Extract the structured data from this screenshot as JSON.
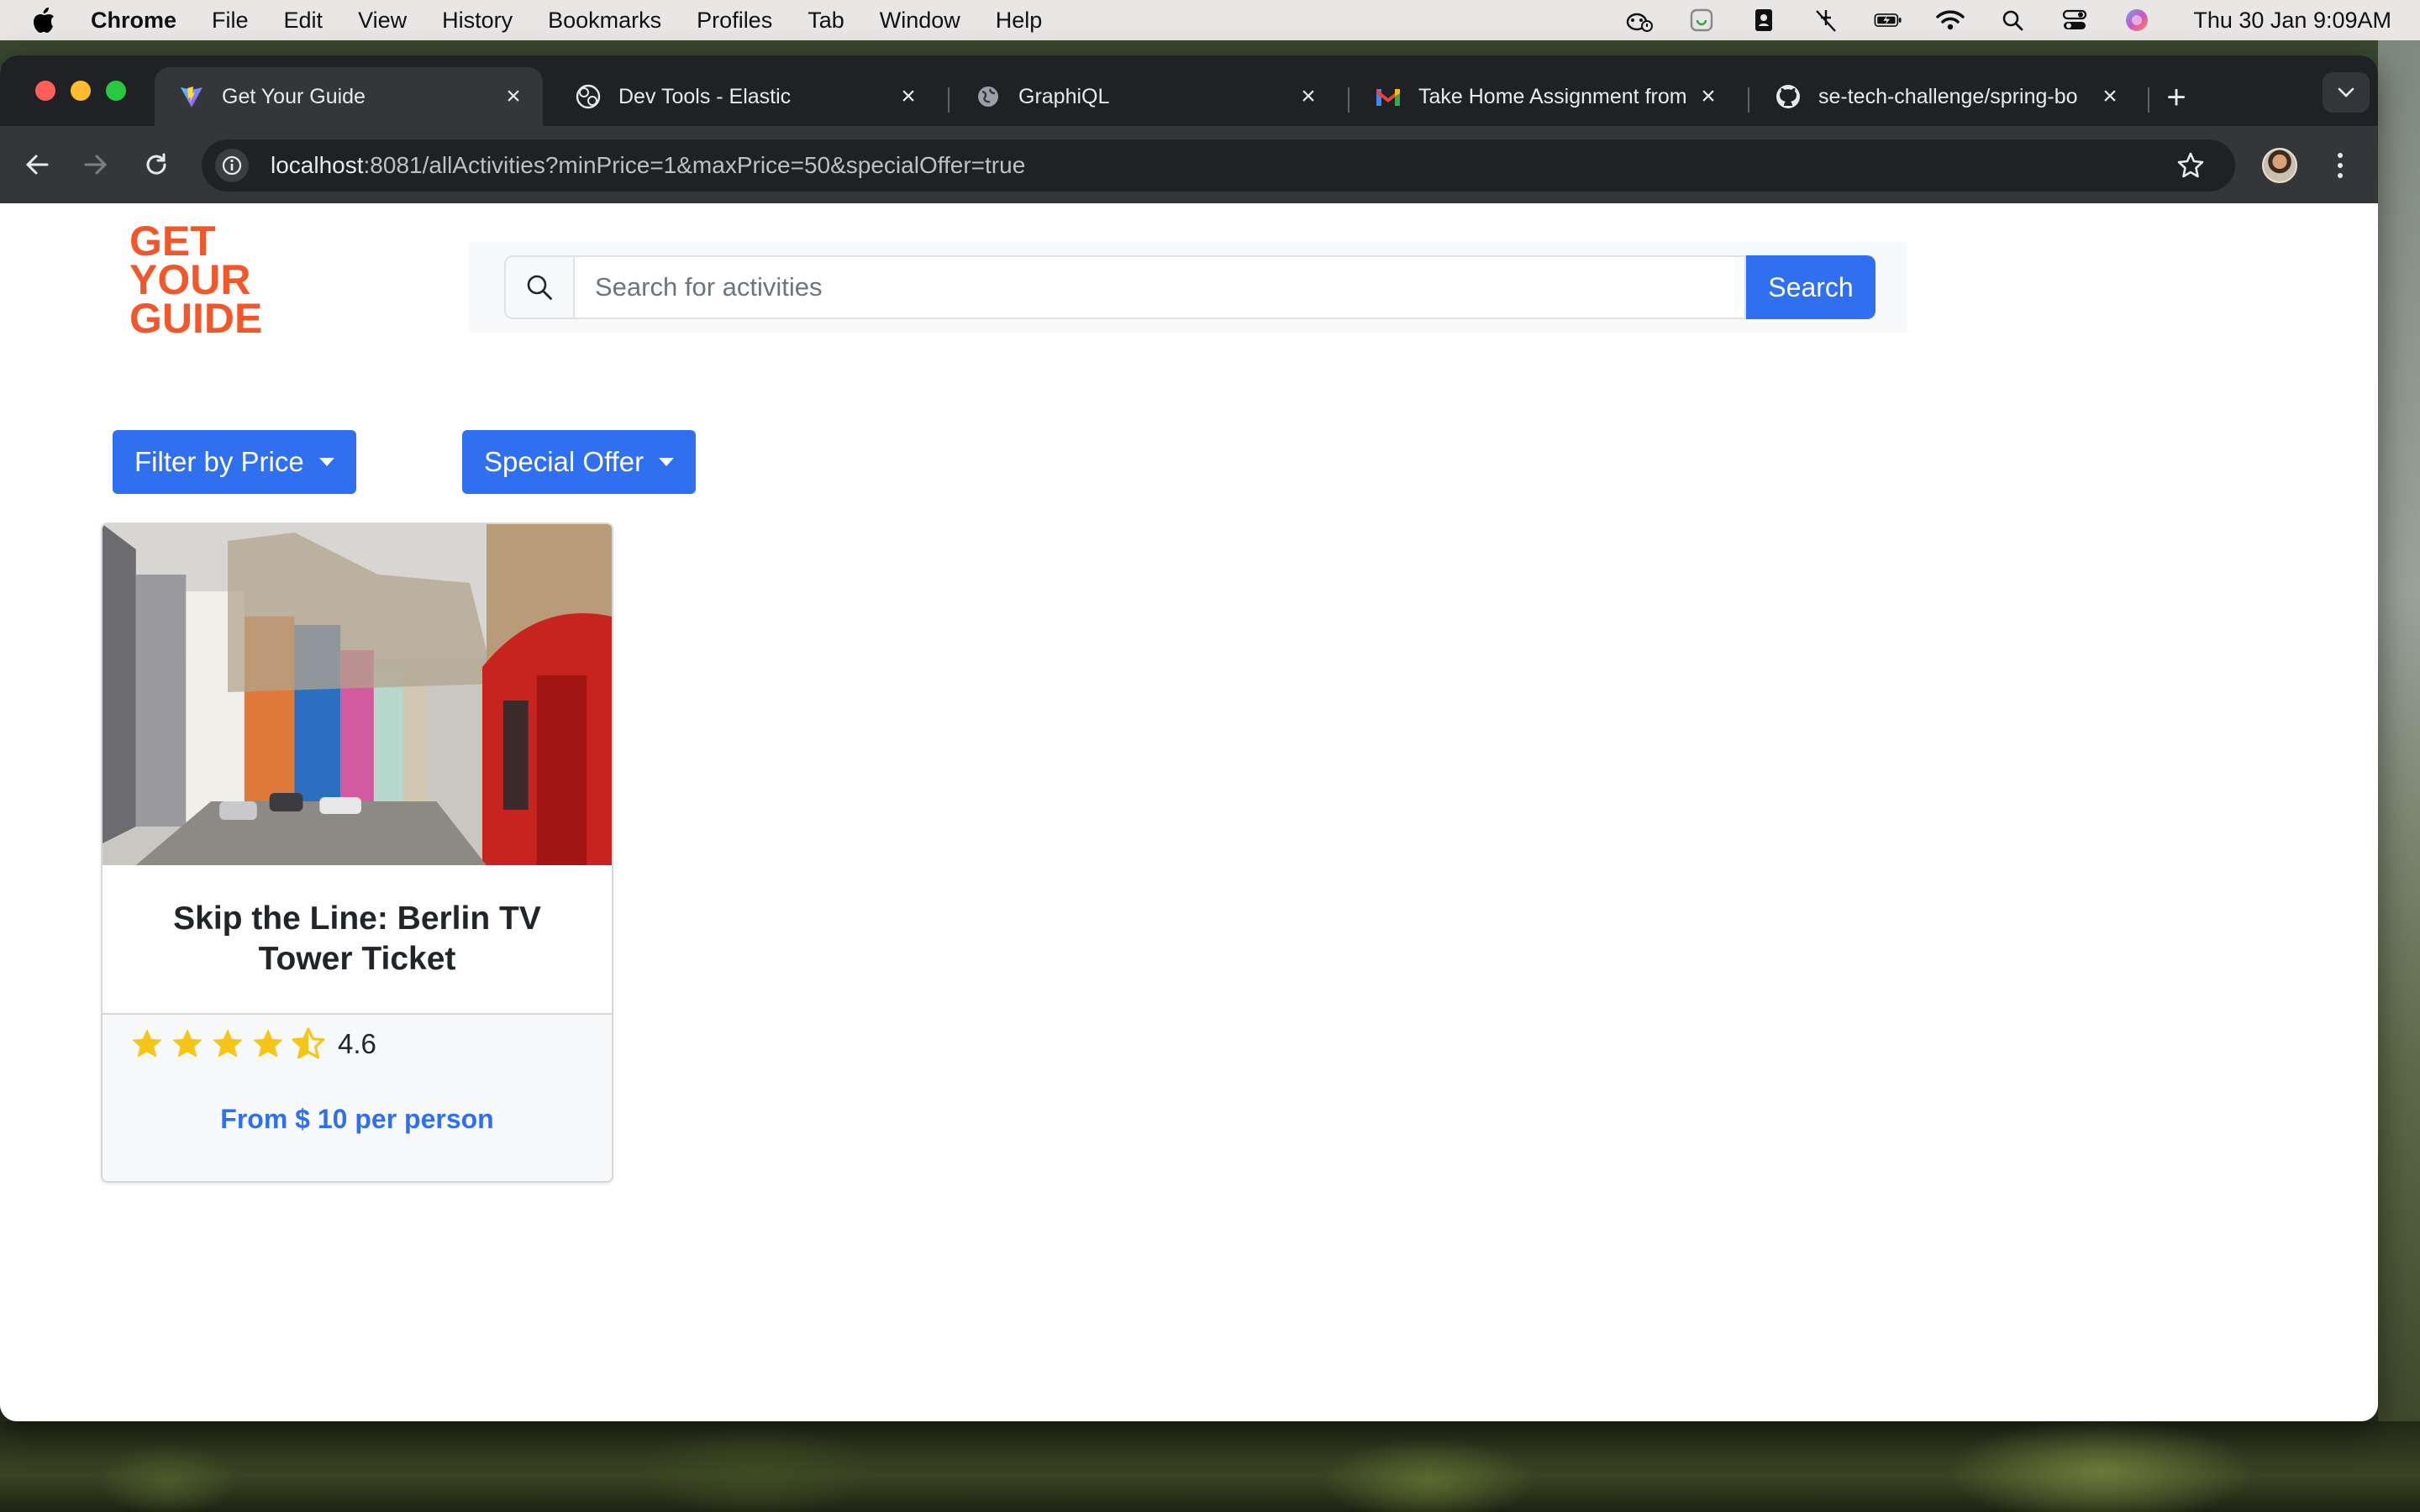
{
  "menubar": {
    "app_name": "Chrome",
    "items": [
      "File",
      "Edit",
      "View",
      "History",
      "Bookmarks",
      "Profiles",
      "Tab",
      "Window",
      "Help"
    ],
    "clock": "Thu 30 Jan  9:09AM"
  },
  "tabs": [
    {
      "title": "Get Your Guide",
      "icon": "vite-icon",
      "active": true
    },
    {
      "title": "Dev Tools - Elastic",
      "icon": "elastic-icon",
      "active": false
    },
    {
      "title": "GraphiQL",
      "icon": "globe-icon",
      "active": false
    },
    {
      "title": "Take Home Assignment from",
      "icon": "gmail-icon",
      "active": false
    },
    {
      "title": "se-tech-challenge/spring-bo",
      "icon": "github-icon",
      "active": false
    }
  ],
  "address_bar": {
    "host": "localhost",
    "path": ":8081/allActivities?minPrice=1&maxPrice=50&specialOffer=true"
  },
  "page": {
    "logo_text": [
      "GET",
      "YOUR",
      "GUIDE"
    ],
    "brand_color": "#f0582b",
    "accent_color": "#2f6ff0",
    "search": {
      "placeholder": "Search for activities",
      "value": "",
      "button_label": "Search"
    },
    "filters": {
      "price_label": "Filter by Price",
      "special_offer_label": "Special Offer"
    },
    "activities": [
      {
        "title": "Skip the Line: Berlin TV Tower Ticket",
        "rating": 4.6,
        "rating_label": "4.6",
        "price_text": "From $ 10 per person"
      }
    ]
  }
}
